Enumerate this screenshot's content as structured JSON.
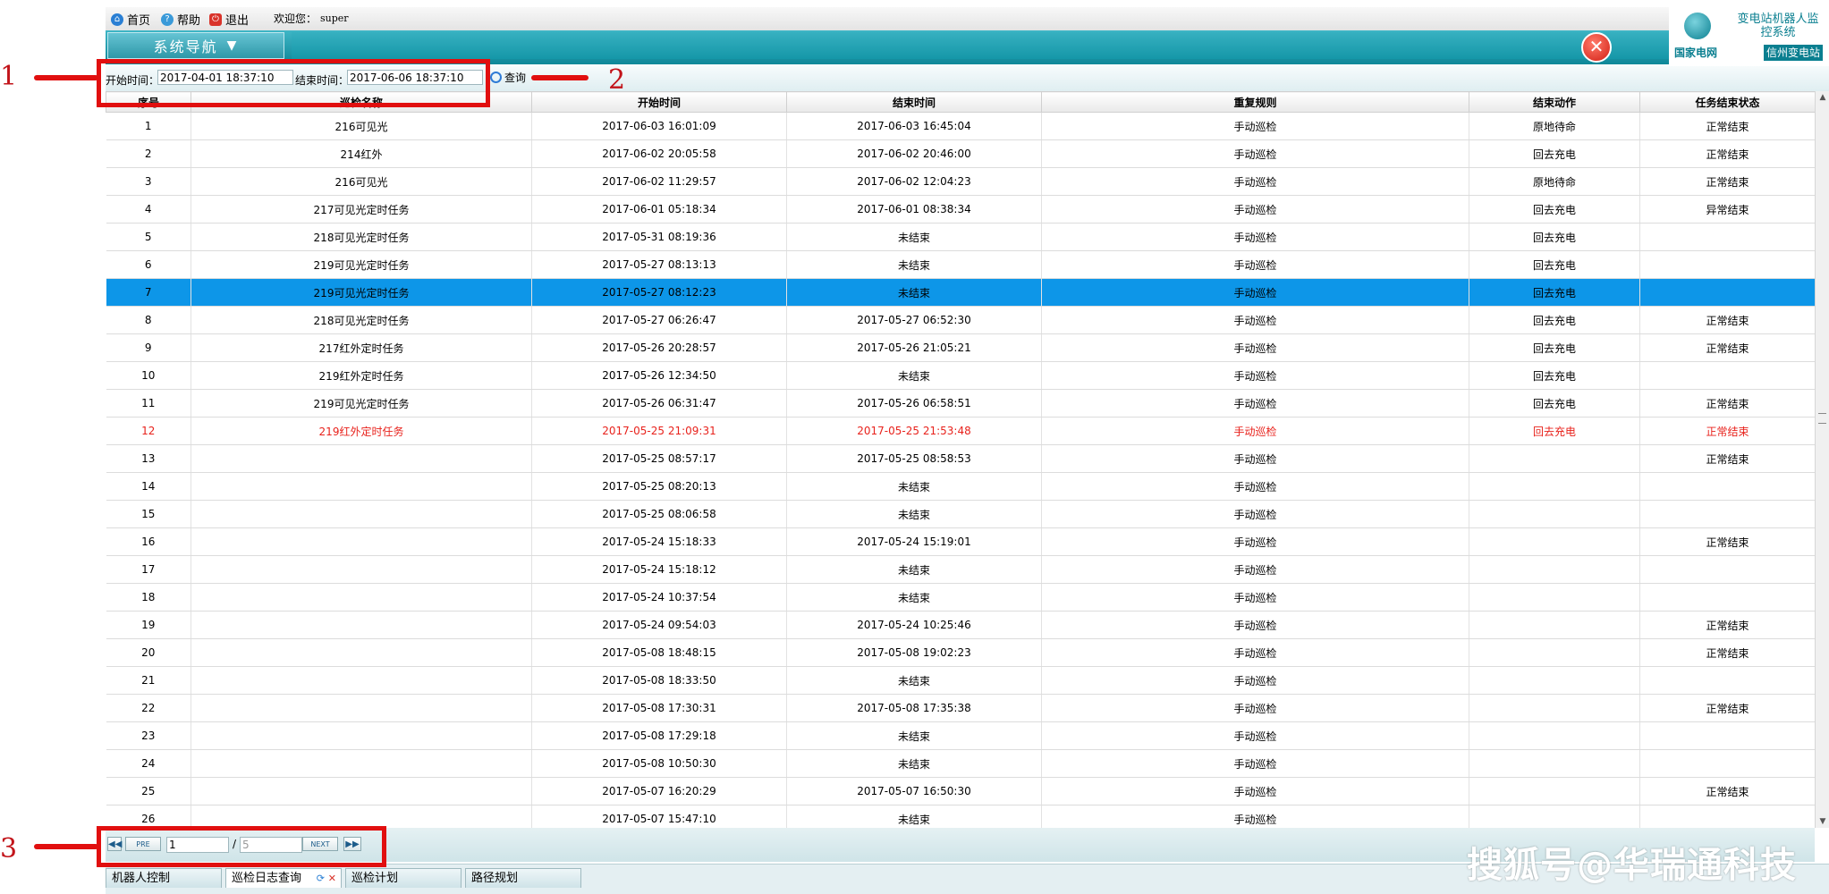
{
  "topbar": {
    "home": "首页",
    "help": "帮助",
    "exit": "退出",
    "welcome": "欢迎您：",
    "user": "super"
  },
  "nav": {
    "label": "系统导航"
  },
  "brand": {
    "title": "变电站机器人监控系统",
    "sgcc": "国家电网",
    "station": "信州变电站"
  },
  "query": {
    "start_label": "开始时间：",
    "start_value": "2017-04-01 18:37:10",
    "end_label": "结束时间：",
    "end_value": "2017-06-06 18:37:10",
    "button": "查询"
  },
  "table": {
    "columns": [
      "序号",
      "巡检名称",
      "开始时间",
      "结束时间",
      "重复规则",
      "结束动作",
      "任务结束状态"
    ],
    "rows": [
      [
        "1",
        "216可见光",
        "2017-06-03 16:01:09",
        "2017-06-03 16:45:04",
        "手动巡检",
        "原地待命",
        "正常结束"
      ],
      [
        "2",
        "214红外",
        "2017-06-02 20:05:58",
        "2017-06-02 20:46:00",
        "手动巡检",
        "回去充电",
        "正常结束"
      ],
      [
        "3",
        "216可见光",
        "2017-06-02 11:29:57",
        "2017-06-02 12:04:23",
        "手动巡检",
        "原地待命",
        "正常结束"
      ],
      [
        "4",
        "217可见光定时任务",
        "2017-06-01 05:18:34",
        "2017-06-01 08:38:34",
        "手动巡检",
        "回去充电",
        "异常结束"
      ],
      [
        "5",
        "218可见光定时任务",
        "2017-05-31 08:19:36",
        "未结束",
        "手动巡检",
        "回去充电",
        ""
      ],
      [
        "6",
        "219可见光定时任务",
        "2017-05-27 08:13:13",
        "未结束",
        "手动巡检",
        "回去充电",
        ""
      ],
      [
        "7",
        "219可见光定时任务",
        "2017-05-27 08:12:23",
        "未结束",
        "手动巡检",
        "回去充电",
        ""
      ],
      [
        "8",
        "218可见光定时任务",
        "2017-05-27 06:26:47",
        "2017-05-27 06:52:30",
        "手动巡检",
        "回去充电",
        "正常结束"
      ],
      [
        "9",
        "217红外定时任务",
        "2017-05-26 20:28:57",
        "2017-05-26 21:05:21",
        "手动巡检",
        "回去充电",
        "正常结束"
      ],
      [
        "10",
        "219红外定时任务",
        "2017-05-26 12:34:50",
        "未结束",
        "手动巡检",
        "回去充电",
        ""
      ],
      [
        "11",
        "219可见光定时任务",
        "2017-05-26 06:31:47",
        "2017-05-26 06:58:51",
        "手动巡检",
        "回去充电",
        "正常结束"
      ],
      [
        "12",
        "219红外定时任务",
        "2017-05-25 21:09:31",
        "2017-05-25 21:53:48",
        "手动巡检",
        "回去充电",
        "正常结束"
      ],
      [
        "13",
        "",
        "2017-05-25 08:57:17",
        "2017-05-25 08:58:53",
        "手动巡检",
        "",
        "正常结束"
      ],
      [
        "14",
        "",
        "2017-05-25 08:20:13",
        "未结束",
        "手动巡检",
        "",
        ""
      ],
      [
        "15",
        "",
        "2017-05-25 08:06:58",
        "未结束",
        "手动巡检",
        "",
        ""
      ],
      [
        "16",
        "",
        "2017-05-24 15:18:33",
        "2017-05-24 15:19:01",
        "手动巡检",
        "",
        "正常结束"
      ],
      [
        "17",
        "",
        "2017-05-24 15:18:12",
        "未结束",
        "手动巡检",
        "",
        ""
      ],
      [
        "18",
        "",
        "2017-05-24 10:37:54",
        "未结束",
        "手动巡检",
        "",
        ""
      ],
      [
        "19",
        "",
        "2017-05-24 09:54:03",
        "2017-05-24 10:25:46",
        "手动巡检",
        "",
        "正常结束"
      ],
      [
        "20",
        "",
        "2017-05-08 18:48:15",
        "2017-05-08 19:02:23",
        "手动巡检",
        "",
        "正常结束"
      ],
      [
        "21",
        "",
        "2017-05-08 18:33:50",
        "未结束",
        "手动巡检",
        "",
        ""
      ],
      [
        "22",
        "",
        "2017-05-08 17:30:31",
        "2017-05-08 17:35:38",
        "手动巡检",
        "",
        "正常结束"
      ],
      [
        "23",
        "",
        "2017-05-08 17:29:18",
        "未结束",
        "手动巡检",
        "",
        ""
      ],
      [
        "24",
        "",
        "2017-05-08 10:50:30",
        "未结束",
        "手动巡检",
        "",
        ""
      ],
      [
        "25",
        "",
        "2017-05-07 16:20:29",
        "2017-05-07 16:50:30",
        "手动巡检",
        "",
        "正常结束"
      ],
      [
        "26",
        "",
        "2017-05-07 15:47:10",
        "未结束",
        "手动巡检",
        "",
        ""
      ]
    ],
    "selected_row": 7,
    "highlight_row": 12,
    "selected_color": "#0d96e8",
    "highlight_color": "#e8221c"
  },
  "pager": {
    "first_icon": "first-page-icon",
    "prev": "PRE",
    "page": "1",
    "separator": "/",
    "total": "5",
    "next": "NEXT",
    "last_icon": "last-page-icon"
  },
  "tabs": [
    {
      "label": "机器人控制",
      "active": false
    },
    {
      "label": "巡检日志查询",
      "active": true
    },
    {
      "label": "巡检计划",
      "active": false
    },
    {
      "label": "路径规划",
      "active": false
    }
  ],
  "annotations": {
    "callouts": [
      "1",
      "2",
      "3"
    ],
    "color": "#e10f0f"
  },
  "watermark": "搜狐号@华瑞通科技"
}
